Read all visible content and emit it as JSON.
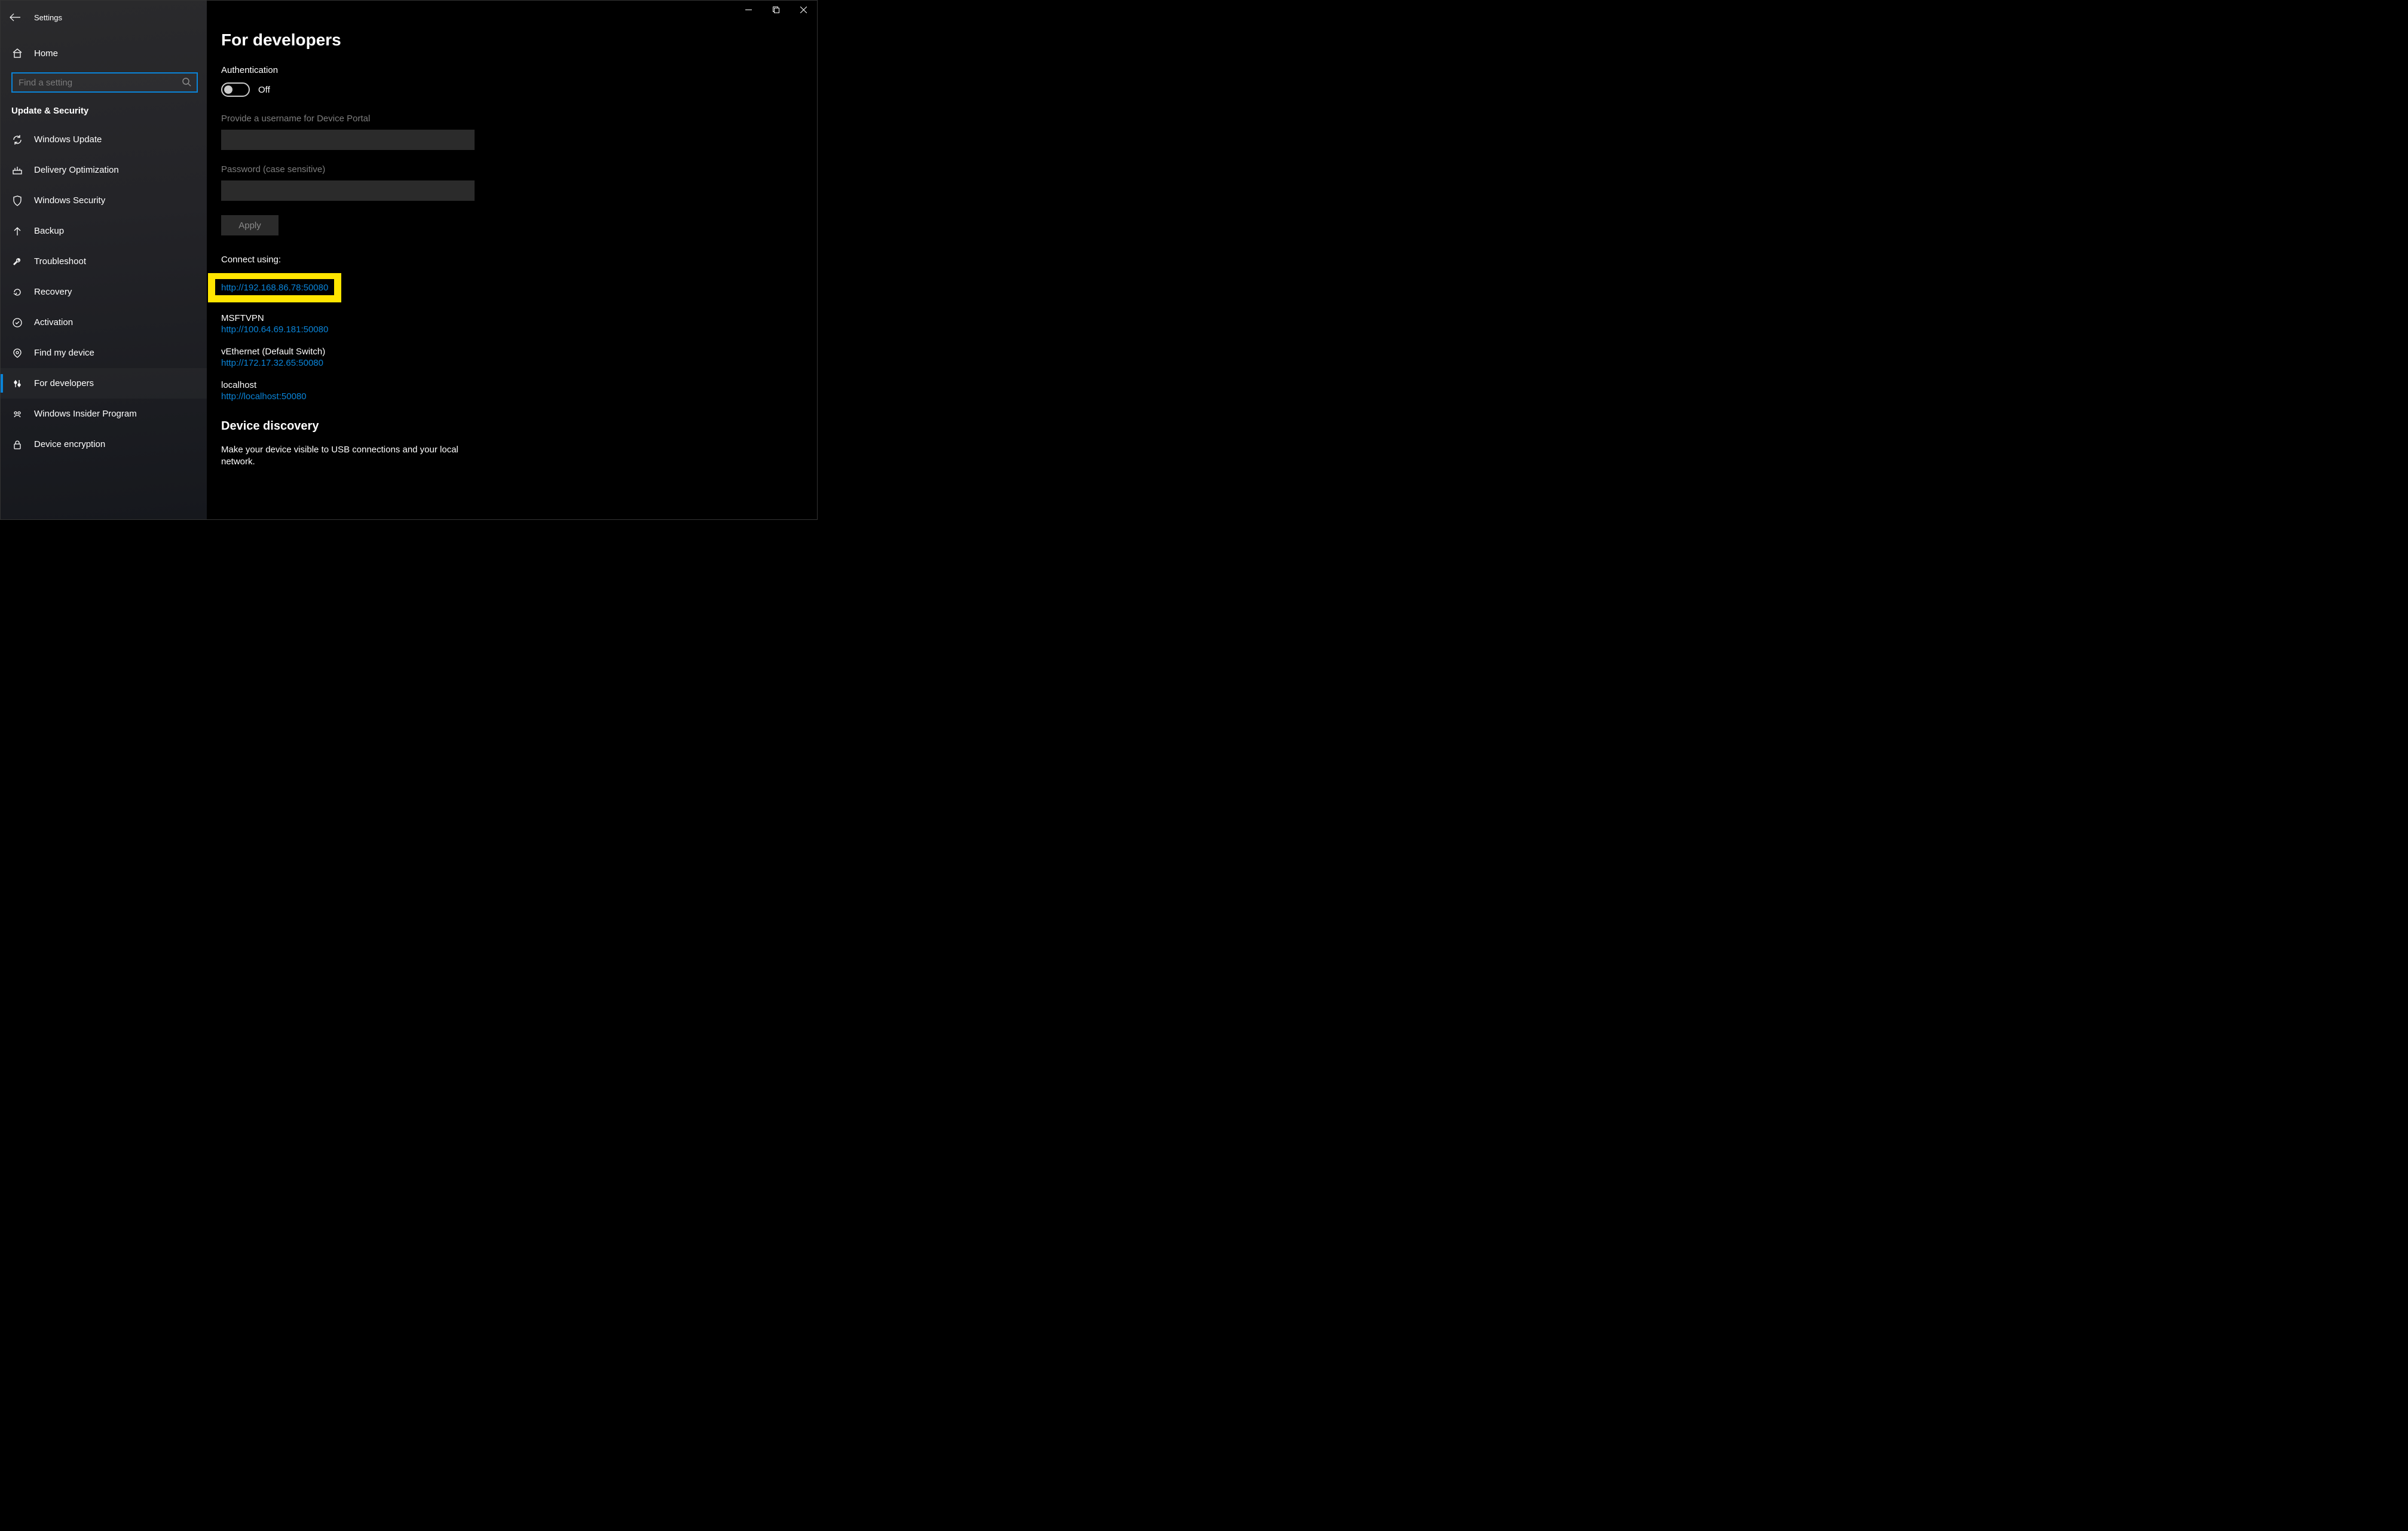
{
  "app_title": "Settings",
  "sidebar": {
    "home_label": "Home",
    "search_placeholder": "Find a setting",
    "section_label": "Update & Security",
    "items": [
      {
        "id": "windows-update",
        "label": "Windows Update"
      },
      {
        "id": "delivery-optimization",
        "label": "Delivery Optimization"
      },
      {
        "id": "windows-security",
        "label": "Windows Security"
      },
      {
        "id": "backup",
        "label": "Backup"
      },
      {
        "id": "troubleshoot",
        "label": "Troubleshoot"
      },
      {
        "id": "recovery",
        "label": "Recovery"
      },
      {
        "id": "activation",
        "label": "Activation"
      },
      {
        "id": "find-my-device",
        "label": "Find my device"
      },
      {
        "id": "for-developers",
        "label": "For developers"
      },
      {
        "id": "windows-insider-program",
        "label": "Windows Insider Program"
      },
      {
        "id": "device-encryption",
        "label": "Device encryption"
      }
    ]
  },
  "main": {
    "page_title": "For developers",
    "auth_heading": "Authentication",
    "toggle_label": "Off",
    "username_label": "Provide a username for Device Portal",
    "password_label": "Password (case sensitive)",
    "apply_label": "Apply",
    "connect_label": "Connect using:",
    "connections": [
      {
        "name": "",
        "url": "http://192.168.86.78:50080",
        "highlighted": true
      },
      {
        "name": "MSFTVPN",
        "url": "http://100.64.69.181:50080"
      },
      {
        "name": "vEthernet (Default Switch)",
        "url": "http://172.17.32.65:50080"
      },
      {
        "name": "localhost",
        "url": "http://localhost:50080"
      }
    ],
    "discovery_title": "Device discovery",
    "discovery_desc": "Make your device visible to USB connections and your local network."
  }
}
